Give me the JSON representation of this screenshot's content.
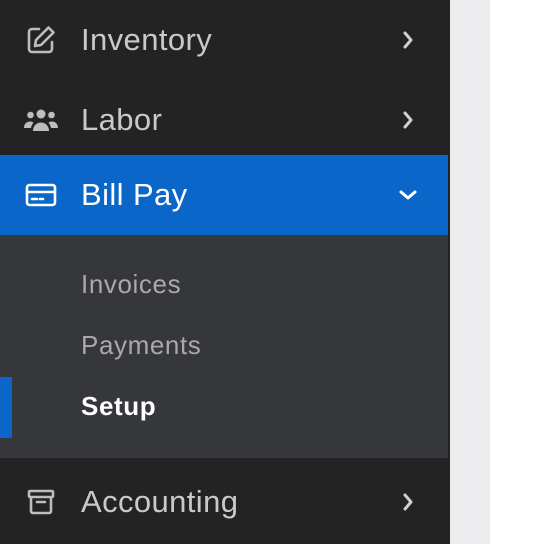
{
  "sidebar": {
    "items": [
      {
        "label": "Inventory",
        "icon": "edit-icon",
        "expanded": false
      },
      {
        "label": "Labor",
        "icon": "users-icon",
        "expanded": false
      },
      {
        "label": "Bill Pay",
        "icon": "credit-card-icon",
        "expanded": true,
        "active": true
      },
      {
        "label": "Accounting",
        "icon": "archive-icon",
        "expanded": false
      }
    ],
    "billpay_submenu": [
      {
        "label": "Invoices"
      },
      {
        "label": "Payments"
      },
      {
        "label": "Setup",
        "active": true
      }
    ]
  },
  "colors": {
    "sidebar_bg": "#232323",
    "submenu_bg": "#36373b",
    "active_bg": "#0b66c9",
    "text_muted": "#c9c9c9",
    "text_active": "#ffffff"
  }
}
